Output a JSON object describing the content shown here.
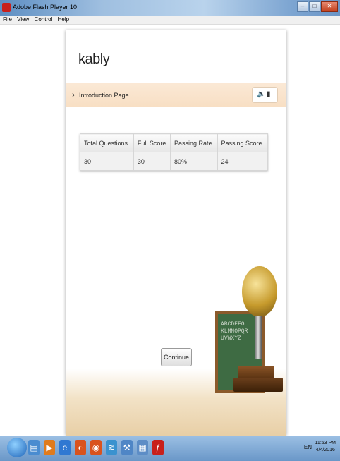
{
  "window": {
    "title": "Adobe Flash Player 10"
  },
  "menu": [
    "File",
    "View",
    "Control",
    "Help"
  ],
  "page": {
    "title": "kably",
    "intro_label": "Introduction Page",
    "speaker_icon": "speaker-icon",
    "device_icon": "device-icon"
  },
  "table": {
    "headers": [
      "Total Questions",
      "Full Score",
      "Passing Rate",
      "Passing Score"
    ],
    "row": [
      "30",
      "30",
      "80%",
      "24"
    ]
  },
  "chalkboard": {
    "lines": [
      "ABCDEFG",
      "KLMNOPQR",
      "UVWXYZ"
    ]
  },
  "continue_label": "Continue",
  "taskbar": {
    "tray_text": "EN",
    "clock_time": "11:53 PM",
    "clock_date": "4/4/2016"
  },
  "colors": {
    "intro_bar": "#f8dfc4",
    "taskbar": "#6a97c8"
  }
}
